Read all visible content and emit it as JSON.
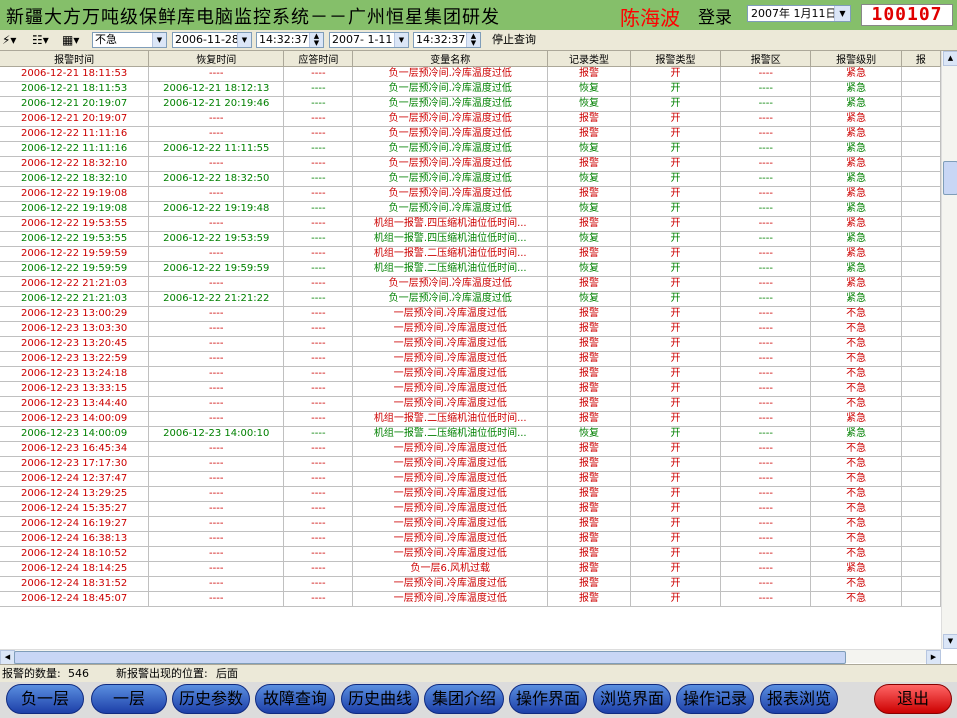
{
  "header": {
    "title": "新疆大方万吨级保鲜库电脑监控系统－－广州恒星集团研发",
    "author": "陈海波",
    "login": "登录",
    "date": "2007年 1月11日",
    "clock": "100107"
  },
  "toolbar": {
    "level_value": "不急",
    "start_date": "2006-11-28",
    "start_time": "14:32:37",
    "end_date": "2007- 1-11",
    "end_time": "14:32:37",
    "stop_label": "停止查询"
  },
  "table": {
    "columns": [
      "报警时间",
      "恢复时间",
      "应答时间",
      "变量名称",
      "记录类型",
      "报警类型",
      "报警区",
      "报警级别",
      "报"
    ],
    "rows": [
      [
        "2006-12-21 18:11:53",
        "----",
        "----",
        "负一层预冷间.冷库温度过低",
        "报警",
        "开",
        "----",
        "紧急"
      ],
      [
        "2006-12-21 18:11:53",
        "2006-12-21 18:12:13",
        "----",
        "负一层预冷间.冷库温度过低",
        "恢复",
        "开",
        "----",
        "紧急"
      ],
      [
        "2006-12-21 20:19:07",
        "2006-12-21 20:19:46",
        "----",
        "负一层预冷间.冷库温度过低",
        "恢复",
        "开",
        "----",
        "紧急"
      ],
      [
        "2006-12-21 20:19:07",
        "----",
        "----",
        "负一层预冷间.冷库温度过低",
        "报警",
        "开",
        "----",
        "紧急"
      ],
      [
        "2006-12-22 11:11:16",
        "----",
        "----",
        "负一层预冷间.冷库温度过低",
        "报警",
        "开",
        "----",
        "紧急"
      ],
      [
        "2006-12-22 11:11:16",
        "2006-12-22 11:11:55",
        "----",
        "负一层预冷间.冷库温度过低",
        "恢复",
        "开",
        "----",
        "紧急"
      ],
      [
        "2006-12-22 18:32:10",
        "----",
        "----",
        "负一层预冷间.冷库温度过低",
        "报警",
        "开",
        "----",
        "紧急"
      ],
      [
        "2006-12-22 18:32:10",
        "2006-12-22 18:32:50",
        "----",
        "负一层预冷间.冷库温度过低",
        "恢复",
        "开",
        "----",
        "紧急"
      ],
      [
        "2006-12-22 19:19:08",
        "----",
        "----",
        "负一层预冷间.冷库温度过低",
        "报警",
        "开",
        "----",
        "紧急"
      ],
      [
        "2006-12-22 19:19:08",
        "2006-12-22 19:19:48",
        "----",
        "负一层预冷间.冷库温度过低",
        "恢复",
        "开",
        "----",
        "紧急"
      ],
      [
        "2006-12-22 19:53:55",
        "----",
        "----",
        "机组一报警.四压缩机油位低时间...",
        "报警",
        "开",
        "----",
        "紧急"
      ],
      [
        "2006-12-22 19:53:55",
        "2006-12-22 19:53:59",
        "----",
        "机组一报警.四压缩机油位低时间...",
        "恢复",
        "开",
        "----",
        "紧急"
      ],
      [
        "2006-12-22 19:59:59",
        "----",
        "----",
        "机组一报警.二压缩机油位低时间...",
        "报警",
        "开",
        "----",
        "紧急"
      ],
      [
        "2006-12-22 19:59:59",
        "2006-12-22 19:59:59",
        "----",
        "机组一报警.二压缩机油位低时间...",
        "恢复",
        "开",
        "----",
        "紧急"
      ],
      [
        "2006-12-22 21:21:03",
        "----",
        "----",
        "负一层预冷间.冷库温度过低",
        "报警",
        "开",
        "----",
        "紧急"
      ],
      [
        "2006-12-22 21:21:03",
        "2006-12-22 21:21:22",
        "----",
        "负一层预冷间.冷库温度过低",
        "恢复",
        "开",
        "----",
        "紧急"
      ],
      [
        "2006-12-23 13:00:29",
        "----",
        "----",
        "一层预冷间.冷库温度过低",
        "报警",
        "开",
        "----",
        "不急"
      ],
      [
        "2006-12-23 13:03:30",
        "----",
        "----",
        "一层预冷间.冷库温度过低",
        "报警",
        "开",
        "----",
        "不急"
      ],
      [
        "2006-12-23 13:20:45",
        "----",
        "----",
        "一层预冷间.冷库温度过低",
        "报警",
        "开",
        "----",
        "不急"
      ],
      [
        "2006-12-23 13:22:59",
        "----",
        "----",
        "一层预冷间.冷库温度过低",
        "报警",
        "开",
        "----",
        "不急"
      ],
      [
        "2006-12-23 13:24:18",
        "----",
        "----",
        "一层预冷间.冷库温度过低",
        "报警",
        "开",
        "----",
        "不急"
      ],
      [
        "2006-12-23 13:33:15",
        "----",
        "----",
        "一层预冷间.冷库温度过低",
        "报警",
        "开",
        "----",
        "不急"
      ],
      [
        "2006-12-23 13:44:40",
        "----",
        "----",
        "一层预冷间.冷库温度过低",
        "报警",
        "开",
        "----",
        "不急"
      ],
      [
        "2006-12-23 14:00:09",
        "----",
        "----",
        "机组一报警.二压缩机油位低时间...",
        "报警",
        "开",
        "----",
        "紧急"
      ],
      [
        "2006-12-23 14:00:09",
        "2006-12-23 14:00:10",
        "----",
        "机组一报警.二压缩机油位低时间...",
        "恢复",
        "开",
        "----",
        "紧急"
      ],
      [
        "2006-12-23 16:45:34",
        "----",
        "----",
        "一层预冷间.冷库温度过低",
        "报警",
        "开",
        "----",
        "不急"
      ],
      [
        "2006-12-23 17:17:30",
        "----",
        "----",
        "一层预冷间.冷库温度过低",
        "报警",
        "开",
        "----",
        "不急"
      ],
      [
        "2006-12-24 12:37:47",
        "----",
        "----",
        "一层预冷间.冷库温度过低",
        "报警",
        "开",
        "----",
        "不急"
      ],
      [
        "2006-12-24 13:29:25",
        "----",
        "----",
        "一层预冷间.冷库温度过低",
        "报警",
        "开",
        "----",
        "不急"
      ],
      [
        "2006-12-24 15:35:27",
        "----",
        "----",
        "一层预冷间.冷库温度过低",
        "报警",
        "开",
        "----",
        "不急"
      ],
      [
        "2006-12-24 16:19:27",
        "----",
        "----",
        "一层预冷间.冷库温度过低",
        "报警",
        "开",
        "----",
        "不急"
      ],
      [
        "2006-12-24 16:38:13",
        "----",
        "----",
        "一层预冷间.冷库温度过低",
        "报警",
        "开",
        "----",
        "不急"
      ],
      [
        "2006-12-24 18:10:52",
        "----",
        "----",
        "一层预冷间.冷库温度过低",
        "报警",
        "开",
        "----",
        "不急"
      ],
      [
        "2006-12-24 18:14:25",
        "----",
        "----",
        "负一层6.风机过载",
        "报警",
        "开",
        "----",
        "紧急"
      ],
      [
        "2006-12-24 18:31:52",
        "----",
        "----",
        "一层预冷间.冷库温度过低",
        "报警",
        "开",
        "----",
        "不急"
      ],
      [
        "2006-12-24 18:45:07",
        "----",
        "----",
        "一层预冷间.冷库温度过低",
        "报警",
        "开",
        "----",
        "不急"
      ]
    ]
  },
  "status": {
    "count_label": "报警的数量:",
    "count_value": "546",
    "position_label": "新报警出现的位置:",
    "position_value": "后面"
  },
  "nav": {
    "buttons": [
      "负一层",
      "一层",
      "历史参数",
      "故障查询",
      "历史曲线",
      "集团介绍",
      "操作界面",
      "浏览界面",
      "操作记录",
      "报表浏览"
    ],
    "exit": "退出"
  }
}
